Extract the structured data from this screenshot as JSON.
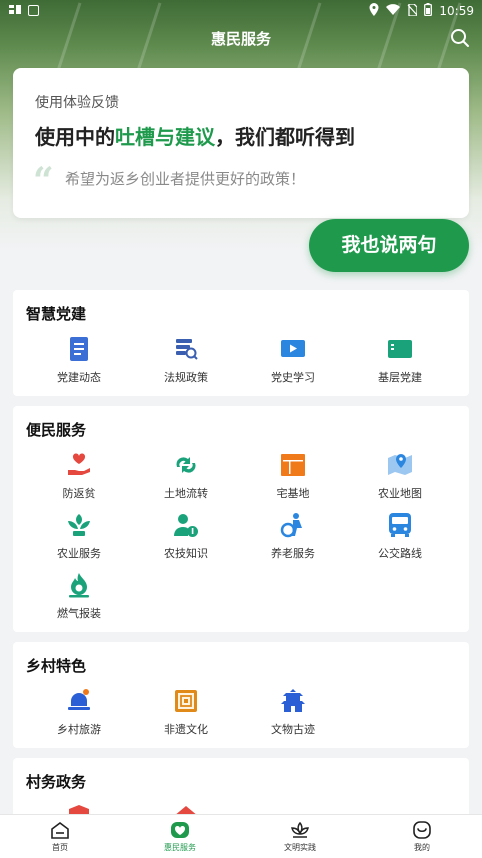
{
  "status_bar": {
    "time": "10:59"
  },
  "header": {
    "title": "惠民服务"
  },
  "feedback": {
    "subtitle": "使用体验反馈",
    "headline_prefix": "使用中的",
    "headline_highlight": "吐槽与建议",
    "headline_suffix": "，我们都听得到",
    "wish_text": "希望为返乡创业者提供更好的政策！",
    "action_label": "我也说两句"
  },
  "sections": [
    {
      "title": "智慧党建",
      "items": [
        {
          "label": "党建动态",
          "icon": "document-icon",
          "color": "#3b6fd6"
        },
        {
          "label": "法规政策",
          "icon": "law-search-icon",
          "color": "#3b5fb0"
        },
        {
          "label": "党史学习",
          "icon": "video-play-icon",
          "color": "#2b86e0"
        },
        {
          "label": "基层党建",
          "icon": "screen-icon",
          "color": "#1aa37a"
        }
      ]
    },
    {
      "title": "便民服务",
      "items": [
        {
          "label": "防返贫",
          "icon": "hand-heart-icon",
          "color": "#e5483f"
        },
        {
          "label": "土地流转",
          "icon": "recycle-icon",
          "color": "#1aa37a"
        },
        {
          "label": "宅基地",
          "icon": "house-grid-icon",
          "color": "#f07a1a"
        },
        {
          "label": "农业地图",
          "icon": "map-pin-icon",
          "color": "#2b86e0"
        },
        {
          "label": "农业服务",
          "icon": "sprout-icon",
          "color": "#1aa37a"
        },
        {
          "label": "农技知识",
          "icon": "person-info-icon",
          "color": "#1aa37a"
        },
        {
          "label": "养老服务",
          "icon": "elderly-icon",
          "color": "#2b86e0"
        },
        {
          "label": "公交路线",
          "icon": "bus-icon",
          "color": "#2b86e0"
        },
        {
          "label": "燃气报装",
          "icon": "gas-flame-icon",
          "color": "#1aa37a"
        }
      ]
    },
    {
      "title": "乡村特色",
      "items": [
        {
          "label": "乡村旅游",
          "icon": "travel-bell-icon",
          "color": "#2b5fd6"
        },
        {
          "label": "非遗文化",
          "icon": "heritage-stamp-icon",
          "color": "#e08a1a"
        },
        {
          "label": "文物古迹",
          "icon": "pagoda-icon",
          "color": "#2b5fd6"
        }
      ]
    },
    {
      "title": "村务政务",
      "items": [
        {
          "label": "",
          "icon": "shield-icon",
          "color": "#e5483f"
        },
        {
          "label": "",
          "icon": "house-icon",
          "color": "#e5483f"
        }
      ]
    }
  ],
  "tabbar": [
    {
      "label": "首页",
      "icon": "home-icon",
      "active": false
    },
    {
      "label": "惠民服务",
      "icon": "heart-badge-icon",
      "active": true
    },
    {
      "label": "文明实践",
      "icon": "lotus-icon",
      "active": false
    },
    {
      "label": "我的",
      "icon": "smile-icon",
      "active": false
    }
  ],
  "colors": {
    "accent": "#1f9a4d",
    "background": "#f2f3f5"
  }
}
